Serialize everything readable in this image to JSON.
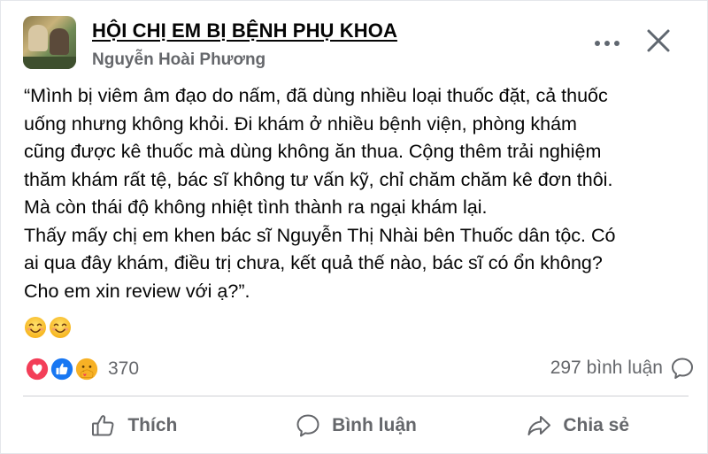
{
  "post": {
    "group_name": "HỘI CHỊ EM BỊ BỆNH PHỤ KHOA",
    "author_name": "Nguyễn Hoài Phương",
    "text_lines": [
      "“Mình bị viêm âm đạo do nấm, đã dùng nhiều loại thuốc đặt, cả thuốc",
      "uống nhưng không khỏi. Đi khám ở nhiều bệnh viện, phòng khám",
      "cũng được kê thuốc mà dùng không ăn thua. Cộng thêm trải nghiệm",
      "thăm khám rất tệ, bác sĩ không tư vấn kỹ, chỉ chăm chăm kê đơn thôi.",
      "Mà còn thái độ không nhiệt tình thành ra ngại khám lại.",
      "Thấy mấy chị em khen bác sĩ Nguyễn Thị Nhài bên Thuốc dân tộc. Có",
      "ai qua đây khám, điều trị chưa, kết quả thế nào, bác sĩ có ổn không?",
      "Cho em xin review với ạ?”."
    ],
    "emojis": [
      "smiling-face",
      "smiling-face"
    ]
  },
  "reactions": {
    "types": [
      "love",
      "like",
      "care"
    ],
    "count": "370"
  },
  "comments": {
    "label": "297 bình luận"
  },
  "actions": {
    "like": "Thích",
    "comment": "Bình luận",
    "share": "Chia sẻ"
  },
  "icons": {
    "more": "more-dots-icon",
    "close": "close-icon"
  },
  "colors": {
    "text": "#050505",
    "secondary": "#65676b",
    "like_blue": "#1877f2",
    "love_red": "#f33e58",
    "care_yellow": "#f7b125"
  }
}
